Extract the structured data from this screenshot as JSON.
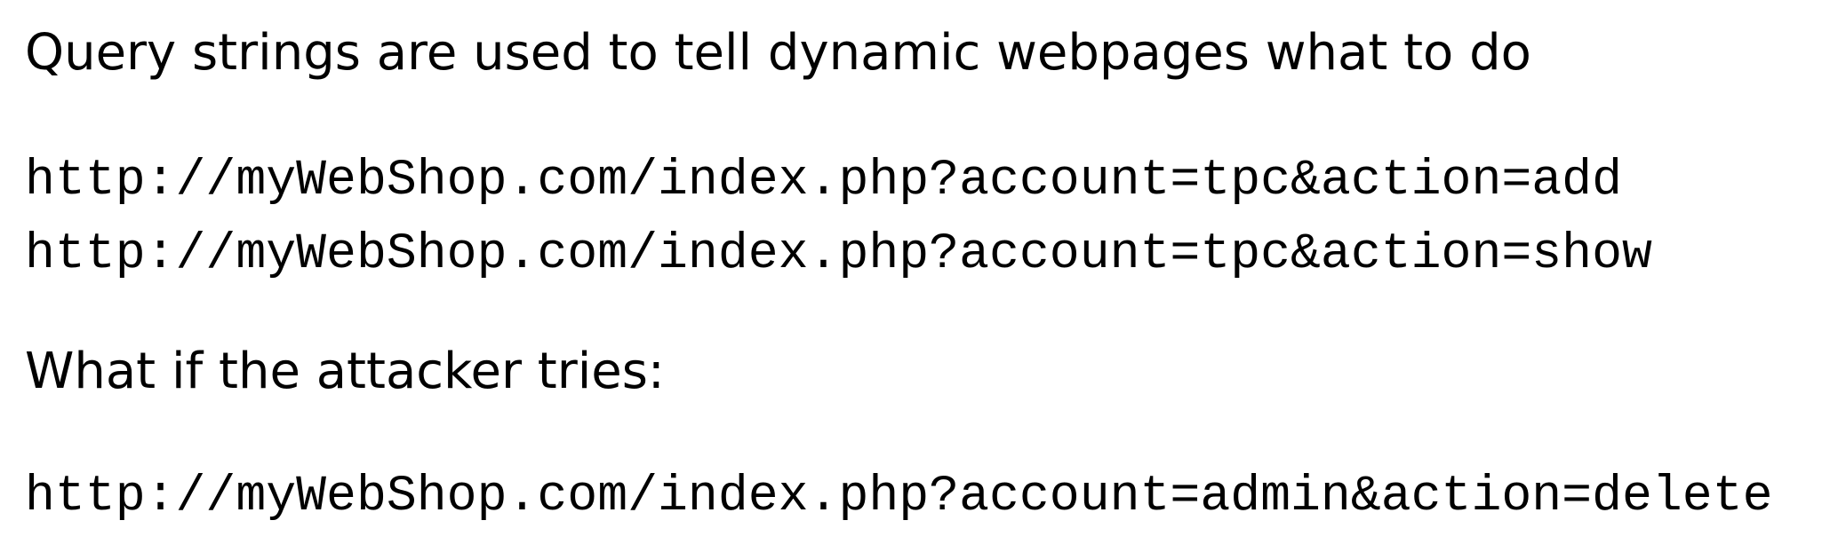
{
  "intro_text": "Query strings are used to tell dynamic webpages what to do",
  "example_urls": [
    "http://myWebShop.com/index.php?account=tpc&action=add",
    "http://myWebShop.com/index.php?account=tpc&action=show"
  ],
  "attacker_question": "What if the attacker tries:",
  "attack_url": "http://myWebShop.com/index.php?account=admin&action=delete"
}
